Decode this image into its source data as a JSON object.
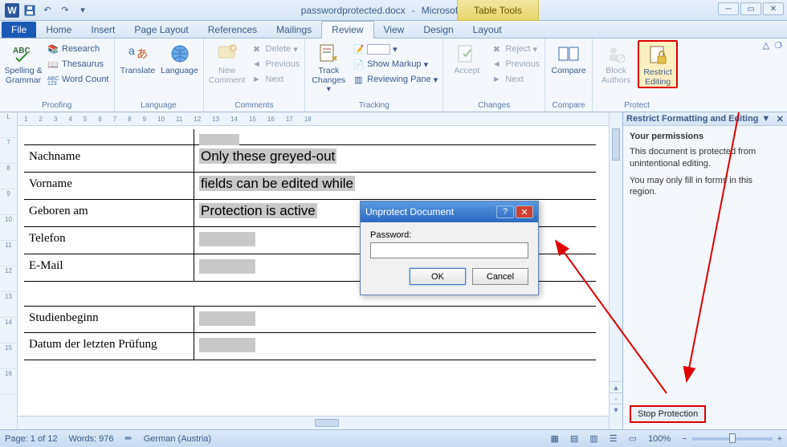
{
  "title": {
    "doc": "passwordprotected.docx",
    "app": "Microsoft Word",
    "context": "Table Tools"
  },
  "tabs": [
    "File",
    "Home",
    "Insert",
    "Page Layout",
    "References",
    "Mailings",
    "Review",
    "View",
    "Design",
    "Layout"
  ],
  "active_tab": "Review",
  "ribbon": {
    "proofing": {
      "label": "Proofing",
      "spelling": "Spelling &\nGrammar",
      "research": "Research",
      "thesaurus": "Thesaurus",
      "wordcount": "Word Count"
    },
    "language": {
      "label": "Language",
      "translate": "Translate",
      "language": "Language"
    },
    "comments": {
      "label": "Comments",
      "newc": "New\nComment",
      "delete": "Delete",
      "previous": "Previous",
      "next": "Next"
    },
    "tracking": {
      "label": "Tracking",
      "track": "Track\nChanges",
      "showmarkup": "Show Markup",
      "reviewing": "Reviewing Pane"
    },
    "changes": {
      "label": "Changes",
      "accept": "Accept",
      "reject": "Reject",
      "previous": "Previous",
      "next": "Next"
    },
    "compare": {
      "label": "Compare",
      "compare": "Compare"
    },
    "protect": {
      "label": "Protect",
      "block": "Block\nAuthors",
      "restrict": "Restrict\nEditing"
    }
  },
  "doc_table": {
    "rows": [
      {
        "a": "Nachname",
        "b": "Only these greyed-out",
        "grey": true
      },
      {
        "a": "Vorname",
        "b": "fields can be edited while",
        "grey": true
      },
      {
        "a": "Geboren am",
        "b": "Protection is active",
        "grey": true
      },
      {
        "a": "Telefon",
        "b": "",
        "box": true
      },
      {
        "a": "E-Mail",
        "b": "",
        "box": true
      }
    ],
    "rows2": [
      {
        "a": "Studienbeginn",
        "b": "",
        "box": true
      },
      {
        "a": "Datum der letzten Prüfung",
        "b": "",
        "box": true
      }
    ]
  },
  "taskpane": {
    "title": "Restrict Formatting and Editing",
    "heading": "Your permissions",
    "p1": "This document is protected from unintentional editing.",
    "p2": "You may only fill in forms in this region.",
    "button": "Stop Protection"
  },
  "dialog": {
    "title": "Unprotect Document",
    "label": "Password:",
    "ok": "OK",
    "cancel": "Cancel"
  },
  "status": {
    "page": "Page: 1 of 12",
    "words": "Words: 976",
    "lang": "German (Austria)",
    "zoom": "100%"
  }
}
